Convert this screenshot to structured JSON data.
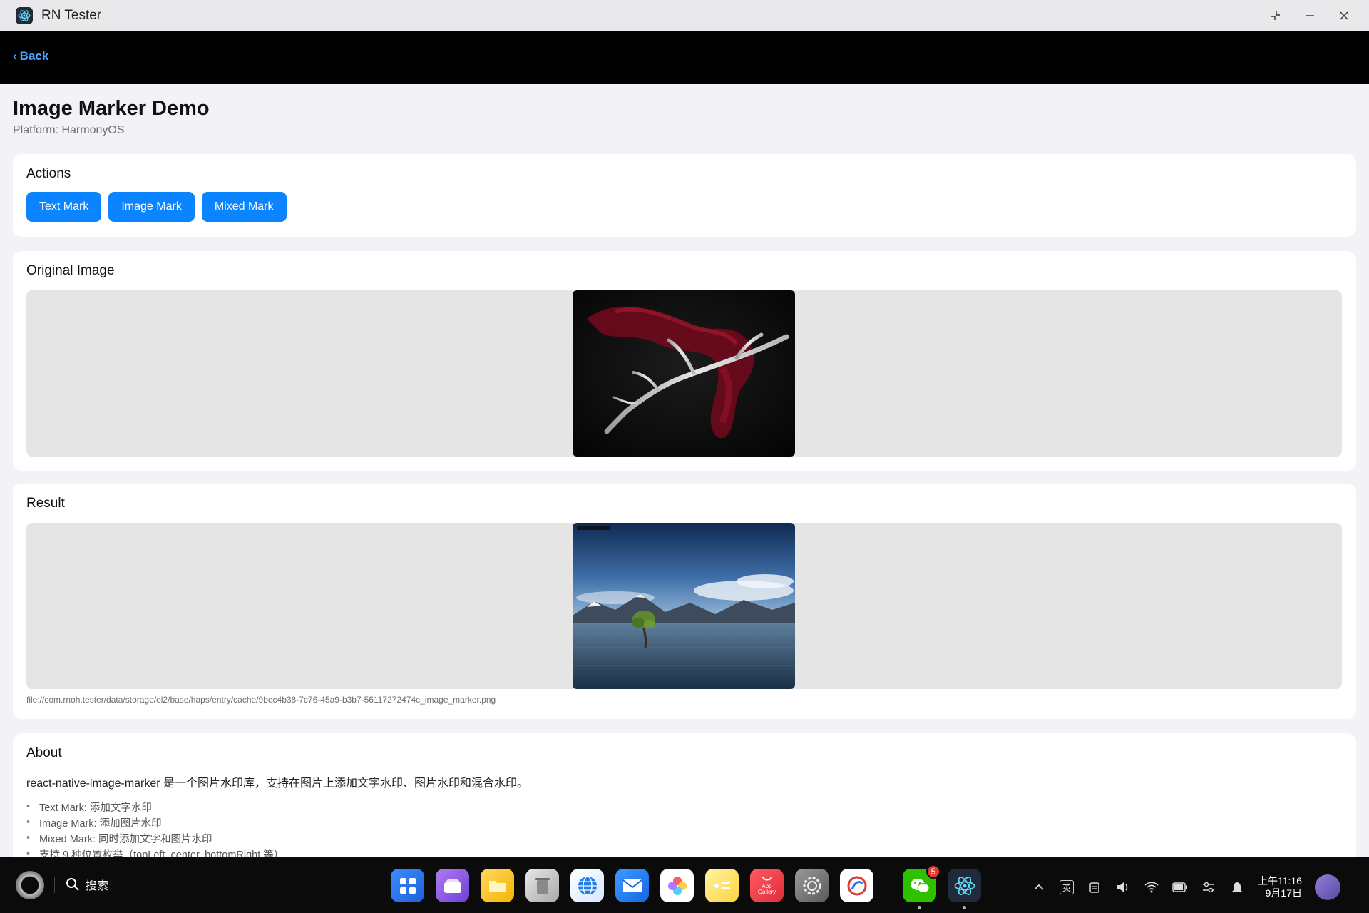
{
  "window": {
    "title": "RN Tester",
    "icon": "react-icon",
    "controls": [
      "restore-icon",
      "minimize-icon",
      "close-icon"
    ]
  },
  "header": {
    "back_label": "Back"
  },
  "page": {
    "title": "Image Marker Demo",
    "subtitle": "Platform: HarmonyOS"
  },
  "actions": {
    "title": "Actions",
    "buttons": [
      "Text Mark",
      "Image Mark",
      "Mixed Mark"
    ],
    "accent_color": "#0a84ff"
  },
  "original": {
    "title": "Original Image"
  },
  "result": {
    "title": "Result",
    "path": "file://com.rnoh.tester/data/storage/el2/base/haps/entry/cache/9bec4b38-7c76-45a9-b3b7-56117272474c_image_marker.png"
  },
  "about": {
    "title": "About",
    "description": "react-native-image-marker 是一个图片水印库，支持在图片上添加文字水印、图片水印和混合水印。",
    "items": [
      "Text Mark: 添加文字水印",
      "Image Mark: 添加图片水印",
      "Mixed Mark: 同时添加文字和图片水印",
      "支持 9 种位置枚举（topLeft, center, bottomRight 等）"
    ]
  },
  "taskbar": {
    "search_label": "搜索",
    "apps": [
      "app-grid-icon",
      "multitask-icon",
      "files-icon",
      "trash-icon",
      "browser-icon",
      "mail-icon",
      "photos-icon",
      "notes-icon",
      "app-gallery-icon",
      "settings-icon",
      "picture-editor-icon",
      "wechat-icon",
      "react-icon"
    ],
    "app_gallery_label": "App\nGallery",
    "wechat_badge": "5",
    "input_method": "英",
    "time": "上午11:16",
    "date": "9月17日"
  }
}
